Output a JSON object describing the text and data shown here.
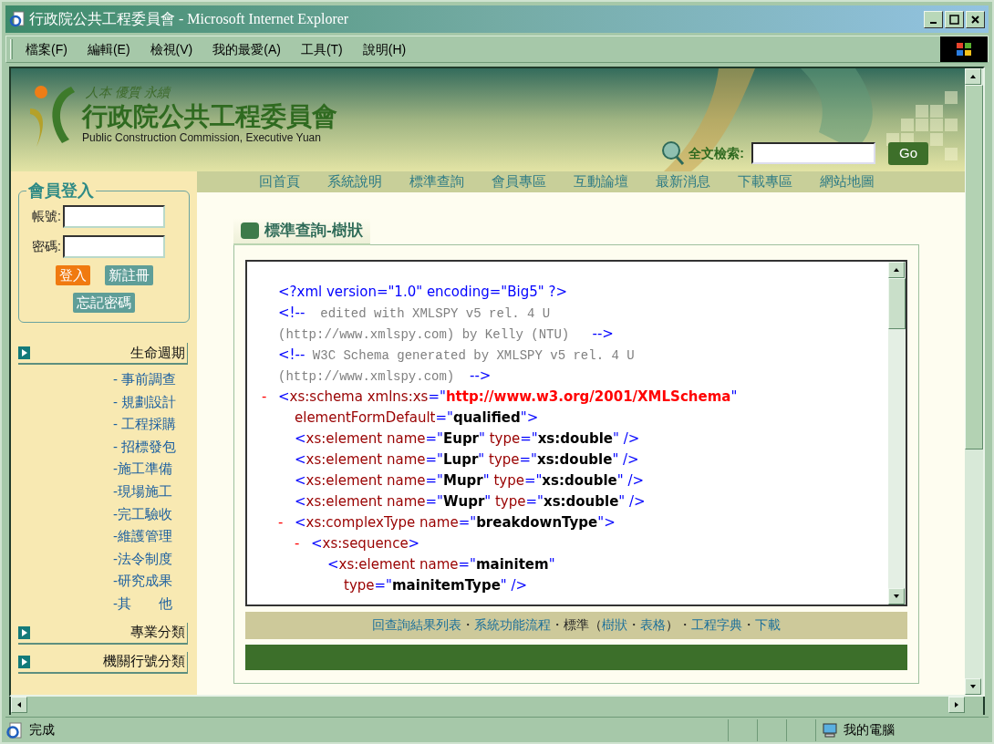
{
  "window": {
    "title": "行政院公共工程委員會 - Microsoft Internet Explorer"
  },
  "menu": [
    "檔案(F)",
    "編輯(E)",
    "檢視(V)",
    "我的最愛(A)",
    "工具(T)",
    "說明(H)"
  ],
  "banner": {
    "slogan": "人本 優質 永續",
    "title": "行政院公共工程委員會",
    "subtitle": "Public Construction Commission, Executive Yuan",
    "search_label": "全文檢索:",
    "search_button": "Go"
  },
  "nav": [
    "回首頁",
    "系統說明",
    "標準查詢",
    "會員專區",
    "互動論壇",
    "最新消息",
    "下載專區",
    "網站地圖"
  ],
  "login": {
    "legend": "會員登入",
    "fields": [
      {
        "label": "帳號:"
      },
      {
        "label": "密碼:"
      }
    ],
    "buttons": [
      {
        "label": "登入",
        "kind": "primary"
      },
      {
        "label": "新註冊",
        "kind": "secondary"
      },
      {
        "label": "忘記密碼",
        "kind": "secondary"
      }
    ]
  },
  "categories": [
    {
      "label": "生命週期",
      "children": [
        "- 事前調查",
        "- 規劃設計",
        "- 工程採購",
        "- 招標發包",
        "-施工準備",
        "-現場施工",
        "-完工驗收",
        "-維護管理",
        "-法令制度",
        "-研究成果",
        "-其　　他"
      ]
    },
    {
      "label": "專業分類"
    },
    {
      "label": "機關行號分類"
    }
  ],
  "panel": {
    "title": "標準查詢-樹狀",
    "xml": [
      {
        "kind": "pi",
        "lines": [
          [
            {
              "kind": "punct",
              "text": "<?xml version=\"1.0\" encoding=\"Big5\" ?>"
            }
          ]
        ]
      },
      {
        "kind": "comment",
        "lines": [
          [
            {
              "kind": "punct",
              "text": "<!--"
            },
            {
              "kind": "comment",
              "text": "  edited with XMLSPY v5 rel. 4 U"
            }
          ],
          [
            {
              "kind": "comment",
              "text": "(http://www.xmlspy.com) by Kelly (NTU)   "
            },
            {
              "kind": "punct",
              "text": "-->"
            }
          ]
        ]
      },
      {
        "kind": "comment",
        "lines": [
          [
            {
              "kind": "punct",
              "text": "<!--"
            },
            {
              "kind": "comment",
              "text": " W3C Schema generated by XMLSPY v5 rel. 4 U"
            }
          ],
          [
            {
              "kind": "comment",
              "text": "(http://www.xmlspy.com)  "
            },
            {
              "kind": "punct",
              "text": "-->"
            }
          ]
        ]
      },
      {
        "kind": "element",
        "toggle": "-",
        "lines": [
          [
            {
              "kind": "punct",
              "text": "<"
            },
            {
              "kind": "name",
              "text": "xs:schema xmlns:xs"
            },
            {
              "kind": "punct",
              "text": "=\""
            },
            {
              "kind": "nsvalue",
              "text": "http://www.w3.org/2001/XMLSchema"
            },
            {
              "kind": "punct",
              "text": "\""
            }
          ],
          [
            {
              "kind": "name",
              "text": "elementFormDefault"
            },
            {
              "kind": "punct",
              "text": "=\""
            },
            {
              "kind": "value",
              "text": "qualified"
            },
            {
              "kind": "punct",
              "text": "\">"
            }
          ]
        ],
        "children": [
          {
            "kind": "element",
            "lines": [
              [
                {
                  "kind": "punct",
                  "text": "<"
                },
                {
                  "kind": "name",
                  "text": "xs:element name"
                },
                {
                  "kind": "punct",
                  "text": "=\""
                },
                {
                  "kind": "value",
                  "text": "Eupr"
                },
                {
                  "kind": "punct",
                  "text": "\" "
                },
                {
                  "kind": "name",
                  "text": "type"
                },
                {
                  "kind": "punct",
                  "text": "=\""
                },
                {
                  "kind": "value",
                  "text": "xs:double"
                },
                {
                  "kind": "punct",
                  "text": "\" />"
                }
              ]
            ]
          },
          {
            "kind": "element",
            "lines": [
              [
                {
                  "kind": "punct",
                  "text": "<"
                },
                {
                  "kind": "name",
                  "text": "xs:element name"
                },
                {
                  "kind": "punct",
                  "text": "=\""
                },
                {
                  "kind": "value",
                  "text": "Lupr"
                },
                {
                  "kind": "punct",
                  "text": "\" "
                },
                {
                  "kind": "name",
                  "text": "type"
                },
                {
                  "kind": "punct",
                  "text": "=\""
                },
                {
                  "kind": "value",
                  "text": "xs:double"
                },
                {
                  "kind": "punct",
                  "text": "\" />"
                }
              ]
            ]
          },
          {
            "kind": "element",
            "lines": [
              [
                {
                  "kind": "punct",
                  "text": "<"
                },
                {
                  "kind": "name",
                  "text": "xs:element name"
                },
                {
                  "kind": "punct",
                  "text": "=\""
                },
                {
                  "kind": "value",
                  "text": "Mupr"
                },
                {
                  "kind": "punct",
                  "text": "\" "
                },
                {
                  "kind": "name",
                  "text": "type"
                },
                {
                  "kind": "punct",
                  "text": "=\""
                },
                {
                  "kind": "value",
                  "text": "xs:double"
                },
                {
                  "kind": "punct",
                  "text": "\" />"
                }
              ]
            ]
          },
          {
            "kind": "element",
            "lines": [
              [
                {
                  "kind": "punct",
                  "text": "<"
                },
                {
                  "kind": "name",
                  "text": "xs:element name"
                },
                {
                  "kind": "punct",
                  "text": "=\""
                },
                {
                  "kind": "value",
                  "text": "Wupr"
                },
                {
                  "kind": "punct",
                  "text": "\" "
                },
                {
                  "kind": "name",
                  "text": "type"
                },
                {
                  "kind": "punct",
                  "text": "=\""
                },
                {
                  "kind": "value",
                  "text": "xs:double"
                },
                {
                  "kind": "punct",
                  "text": "\" />"
                }
              ]
            ]
          },
          {
            "kind": "element",
            "toggle": "-",
            "lines": [
              [
                {
                  "kind": "punct",
                  "text": "<"
                },
                {
                  "kind": "name",
                  "text": "xs:complexType name"
                },
                {
                  "kind": "punct",
                  "text": "=\""
                },
                {
                  "kind": "value",
                  "text": "breakdownType"
                },
                {
                  "kind": "punct",
                  "text": "\">"
                }
              ]
            ],
            "children": [
              {
                "kind": "element",
                "toggle": "-",
                "lines": [
                  [
                    {
                      "kind": "punct",
                      "text": "<"
                    },
                    {
                      "kind": "name",
                      "text": "xs:sequence"
                    },
                    {
                      "kind": "punct",
                      "text": ">"
                    }
                  ]
                ],
                "children": [
                  {
                    "kind": "element",
                    "lines": [
                      [
                        {
                          "kind": "punct",
                          "text": "<"
                        },
                        {
                          "kind": "name",
                          "text": "xs:element name"
                        },
                        {
                          "kind": "punct",
                          "text": "=\""
                        },
                        {
                          "kind": "value",
                          "text": "mainitem"
                        },
                        {
                          "kind": "punct",
                          "text": "\""
                        }
                      ],
                      [
                        {
                          "kind": "name",
                          "text": "type"
                        },
                        {
                          "kind": "punct",
                          "text": "=\""
                        },
                        {
                          "kind": "value",
                          "text": "mainitemType"
                        },
                        {
                          "kind": "punct",
                          "text": "\" />"
                        }
                      ]
                    ]
                  }
                ]
              }
            ]
          }
        ]
      }
    ]
  },
  "footer_links": [
    {
      "text": "回查詢結果列表",
      "kind": "link"
    },
    {
      "text": "・",
      "kind": "text"
    },
    {
      "text": "系統功能流程",
      "kind": "link"
    },
    {
      "text": "・",
      "kind": "text"
    },
    {
      "text": "標準",
      "kind": "text"
    },
    {
      "text": "（",
      "kind": "text"
    },
    {
      "text": "樹狀",
      "kind": "link"
    },
    {
      "text": "・",
      "kind": "text"
    },
    {
      "text": "表格",
      "kind": "link"
    },
    {
      "text": "）",
      "kind": "text"
    },
    {
      "text": "・",
      "kind": "text"
    },
    {
      "text": "工程字典",
      "kind": "link"
    },
    {
      "text": "・",
      "kind": "text"
    },
    {
      "text": "下載",
      "kind": "link"
    }
  ],
  "status_bar": {
    "text": "完成",
    "zone": "我的電腦"
  }
}
